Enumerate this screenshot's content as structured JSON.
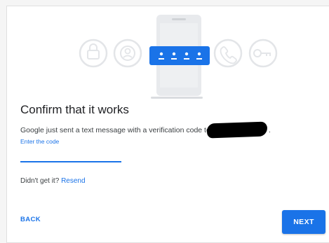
{
  "page": {
    "title": "Confirm that it works",
    "description": "Google just sent a text message with a verification code to",
    "description_end": ".",
    "code_label": "Enter the code",
    "code_value": "",
    "resend_prompt": "Didn't get it?",
    "resend_link": "Resend",
    "back_label": "BACK",
    "next_label": "NEXT"
  },
  "illustration": {
    "icons": [
      "lock-icon",
      "account-icon",
      "phone-with-code",
      "phone-call-icon",
      "key-icon"
    ]
  },
  "colors": {
    "accent": "#1a73e8",
    "icon_gray": "#e8eaed",
    "text": "#202124"
  }
}
